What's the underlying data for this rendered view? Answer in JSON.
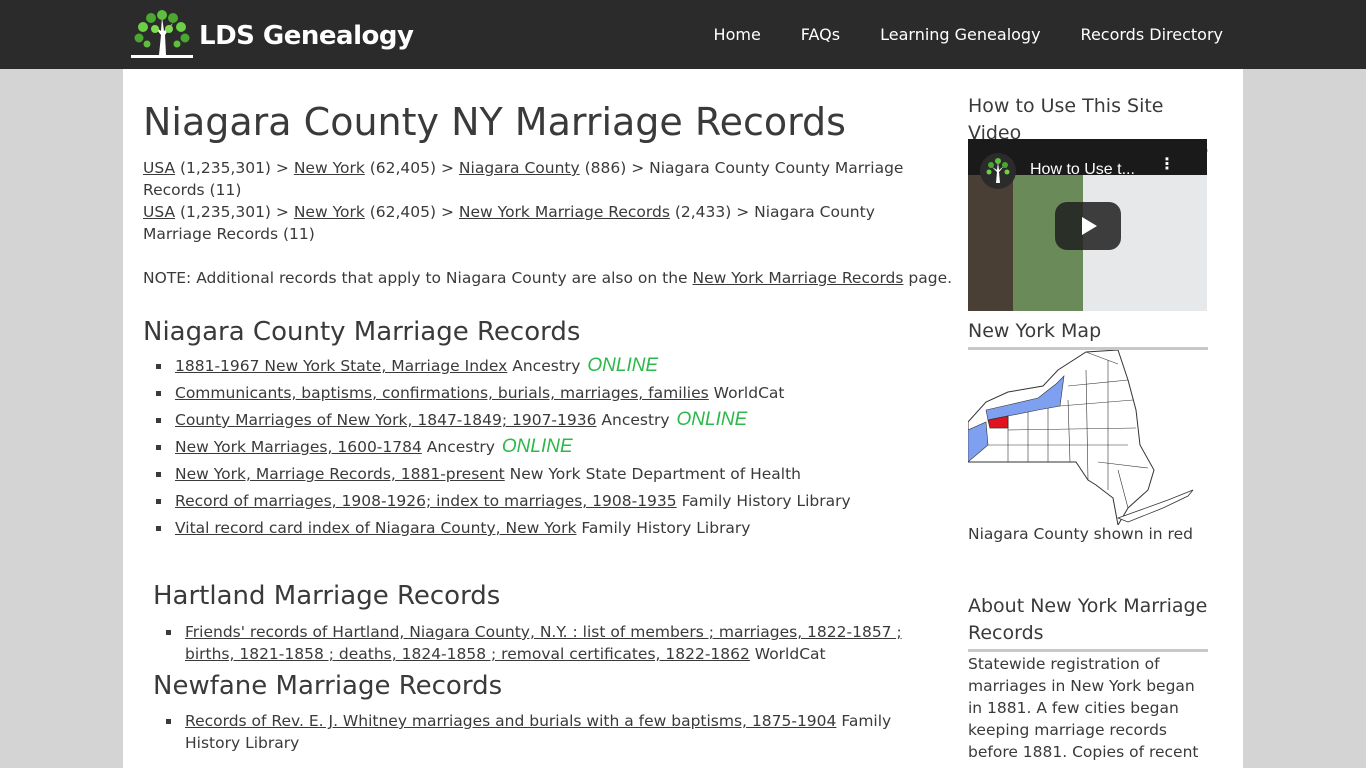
{
  "header": {
    "logo_text": "LDS Genealogy",
    "nav": [
      "Home",
      "FAQs",
      "Learning Genealogy",
      "Records Directory"
    ]
  },
  "page": {
    "title": "Niagara County NY Marriage Records",
    "breadcrumb1": {
      "usa": "USA",
      "usa_count": " (1,235,301) > ",
      "ny": "New York",
      "ny_count": " (62,405) > ",
      "county": "Niagara County",
      "county_count": " (886) > Niagara County County Marriage Records (11)"
    },
    "breadcrumb2": {
      "usa": "USA",
      "usa_count": " (1,235,301) > ",
      "ny": "New York",
      "ny_count": " (62,405) > ",
      "nymr": "New York Marriage Records",
      "rest": " (2,433) > Niagara County Marriage Records (11)"
    },
    "note_prefix": "NOTE: Additional records that apply to Niagara County are also on the ",
    "note_link": "New York Marriage Records",
    "note_suffix": " page."
  },
  "county_section": {
    "heading": "Niagara County Marriage Records",
    "items": [
      {
        "link": "1881-1967 New York State, Marriage Index",
        "source": " Ancestry ",
        "online": "ONLINE"
      },
      {
        "link": "Communicants, baptisms, confirmations, burials, marriages, families",
        "source": " WorldCat",
        "online": ""
      },
      {
        "link": "County Marriages of New York, 1847-1849; 1907-1936",
        "source": " Ancestry ",
        "online": "ONLINE"
      },
      {
        "link": "New York Marriages, 1600-1784",
        "source": " Ancestry ",
        "online": "ONLINE"
      },
      {
        "link": "New York, Marriage Records, 1881-present",
        "source": " New York State Department of Health",
        "online": ""
      },
      {
        "link": "Record of marriages, 1908-1926; index to marriages, 1908-1935",
        "source": " Family History Library",
        "online": ""
      },
      {
        "link": "Vital record card index of Niagara County, New York",
        "source": " Family History Library",
        "online": ""
      }
    ]
  },
  "hartland": {
    "heading": "Hartland Marriage Records",
    "link": "Friends' records of Hartland, Niagara County, N.Y. : list of members ; marriages, 1822-1857 ; births, 1821-1858 ; deaths, 1824-1858 ; removal certificates, 1822-1862",
    "source": " WorldCat"
  },
  "newfane": {
    "heading": "Newfane Marriage Records",
    "link": "Records of Rev. E. J. Whitney marriages and burials with a few baptisms, 1875-1904",
    "source": " Family History Library"
  },
  "sidebar": {
    "video_heading": "How to Use This Site Video",
    "video_title": "How to Use t...",
    "map_heading": "New York Map",
    "map_caption": "Niagara County shown in red",
    "about_heading": "About New York Marriage Records",
    "about_text": "Statewide registration of marriages in New York began in 1881. A few cities began keeping marriage records before 1881. Copies of recent"
  },
  "colors": {
    "online": "#2cb84a",
    "header": "#2b2b2b",
    "county_highlight": "#e0141e",
    "lake": "#7f9ff0"
  }
}
